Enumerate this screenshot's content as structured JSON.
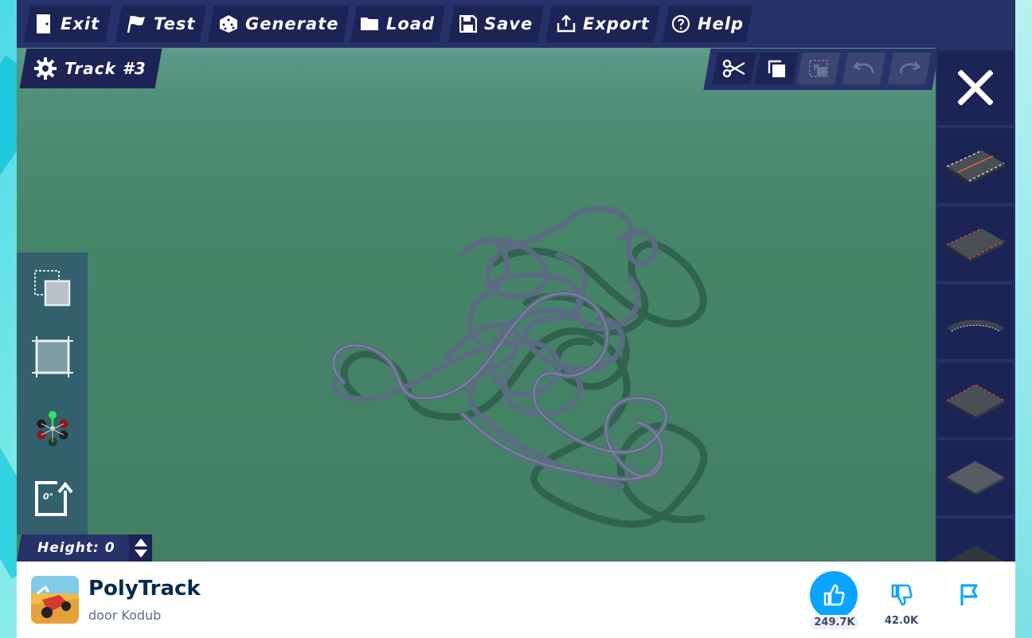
{
  "menu": {
    "items": [
      {
        "label": "Exit",
        "icon": "exit-door-icon"
      },
      {
        "label": "Test",
        "icon": "flag-icon"
      },
      {
        "label": "Generate",
        "icon": "dice-icon"
      },
      {
        "label": "Load",
        "icon": "folder-icon"
      },
      {
        "label": "Save",
        "icon": "floppy-icon"
      },
      {
        "label": "Export",
        "icon": "export-icon"
      },
      {
        "label": "Help",
        "icon": "help-circle-icon"
      }
    ]
  },
  "track": {
    "name": "Track #3",
    "icon": "gear-icon"
  },
  "edit_tools": [
    {
      "name": "cut",
      "icon": "scissors-icon",
      "enabled": true
    },
    {
      "name": "copy",
      "icon": "copy-icon",
      "enabled": true
    },
    {
      "name": "paste",
      "icon": "paste-icon",
      "enabled": false
    },
    {
      "name": "undo",
      "icon": "undo-icon",
      "enabled": false
    },
    {
      "name": "redo",
      "icon": "redo-icon",
      "enabled": false
    }
  ],
  "left_tools": [
    {
      "name": "select-area",
      "icon": "select-area-icon"
    },
    {
      "name": "select-box",
      "icon": "select-box-icon"
    },
    {
      "name": "move",
      "icon": "move-gizmo-icon"
    },
    {
      "name": "rotate",
      "icon": "rotate-icon",
      "value": "0°"
    }
  ],
  "height": {
    "label": "Height: 0"
  },
  "parts": [
    {
      "name": "start-straight",
      "icon": "start-block-icon"
    },
    {
      "name": "checkpoint",
      "icon": "checkpoint-block-icon"
    },
    {
      "name": "curve",
      "icon": "curve-block-icon"
    },
    {
      "name": "finish",
      "icon": "finish-block-icon"
    },
    {
      "name": "plain-block",
      "icon": "plain-block-icon"
    },
    {
      "name": "dark-block",
      "icon": "dark-block-icon"
    }
  ],
  "game": {
    "title": "PolyTrack",
    "author": "door Kodub",
    "likes": "249.7K",
    "dislikes": "42.0K"
  },
  "colors": {
    "menu_bg": "#27316a",
    "button_bg": "#1b2455",
    "accent_blue": "#0aa5ff",
    "title_color": "#002b50",
    "ground": "#437f64",
    "track": "#5b6b82"
  }
}
